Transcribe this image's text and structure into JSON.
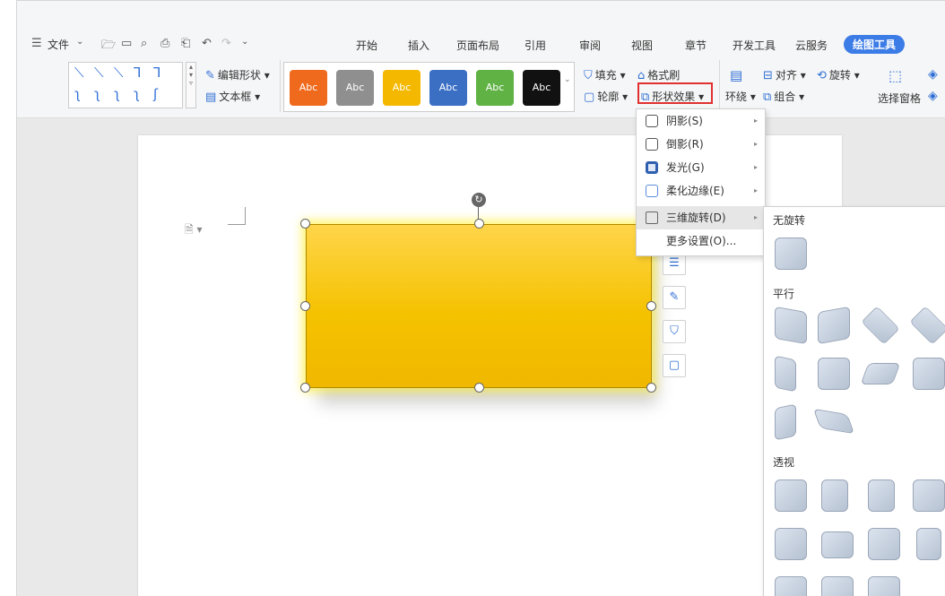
{
  "quick_access": {
    "menu_label": "文件"
  },
  "tabs": [
    "开始",
    "插入",
    "页面布局",
    "引用",
    "审阅",
    "视图",
    "章节",
    "开发工具",
    "云服务",
    "绘图工具"
  ],
  "ribbon": {
    "edit_shape": "编辑形状",
    "textbox": "文本框",
    "fill": "填充",
    "format_painter": "格式刷",
    "outline": "轮廓",
    "shape_effects": "形状效果",
    "wrap": "环绕",
    "align": "对齐",
    "rotate": "旋转",
    "group": "组合",
    "selection_pane": "选择窗格",
    "style_presets": [
      {
        "label": "Abc",
        "color": "#f06a1e"
      },
      {
        "label": "Abc",
        "color": "#8f8f8f"
      },
      {
        "label": "Abc",
        "color": "#f5b800"
      },
      {
        "label": "Abc",
        "color": "#3a6fc4"
      },
      {
        "label": "Abc",
        "color": "#5fb243"
      },
      {
        "label": "Abc",
        "color": "#111111"
      }
    ]
  },
  "effects_menu": {
    "items": [
      {
        "label": "阴影(S)",
        "submenu": true
      },
      {
        "label": "倒影(R)",
        "submenu": true
      },
      {
        "label": "发光(G)",
        "submenu": true
      },
      {
        "label": "柔化边缘(E)",
        "submenu": true
      },
      {
        "label": "三维旋转(D)",
        "submenu": true
      },
      {
        "label": "更多设置(O)...",
        "submenu": false
      }
    ]
  },
  "rotation_submenu": {
    "no_rotation": "无旋转",
    "parallel": "平行",
    "perspective": "透视"
  },
  "colors": {
    "accent": "#3c7ce6",
    "shape_fill": "#f5c200",
    "highlight": "#e03030"
  }
}
